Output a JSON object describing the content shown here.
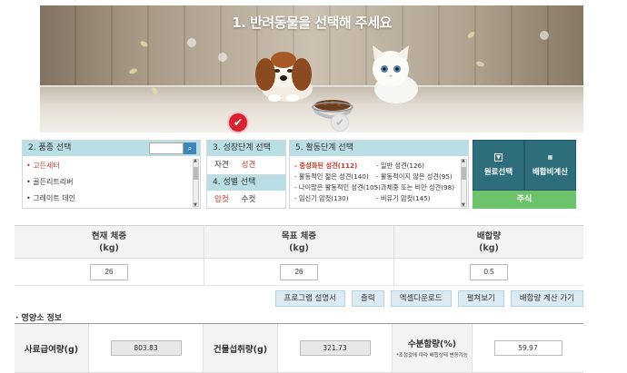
{
  "banner": {
    "title": "1. 반려동물을 선택해 주세요",
    "selected_animal": "dog"
  },
  "breed": {
    "header": "2. 품종 선택",
    "search": {
      "value": ""
    },
    "items": [
      "고든세터",
      "골든리트리버",
      "그레이트 데인"
    ],
    "selected_index": 0
  },
  "stage": {
    "header": "3. 성장단계 선택",
    "options": [
      "자견",
      "성견"
    ],
    "selected_index": 1
  },
  "gender": {
    "header": "4. 성별 선택",
    "options": [
      "암컷",
      "수컷"
    ],
    "selected_index": 0
  },
  "activity": {
    "header": "5. 활동단계 선택",
    "rows": [
      [
        "- 중성화된 성견(112)",
        "- 일반 성견(126)"
      ],
      [
        "- 활동적인 젊은 성견(140)",
        "- 활동적이지 않은 성견(95)"
      ],
      [
        "- 나이많은 활동적인 성견(105)",
        "- 과체중 또는 비만 성견(98)"
      ],
      [
        "- 임신기 암컷(130)",
        "- 비유기 암컷(145)"
      ]
    ],
    "selected": "- 중성화된 성견(112)"
  },
  "buttons": {
    "raw": "원료선택",
    "mix": "배합비계산",
    "main": "주식"
  },
  "weights": {
    "headers": [
      {
        "line1": "현재 체중",
        "line2": "(kg)"
      },
      {
        "line1": "목표 체중",
        "line2": "(kg)"
      },
      {
        "line1": "배합량",
        "line2": "(kg)"
      }
    ],
    "values": [
      "26",
      "26",
      "0.5"
    ]
  },
  "actions": [
    "프로그램 설명서",
    "출력",
    "엑셀다운로드",
    "펼쳐보기",
    "배합량 계산 가기"
  ],
  "nutrition": {
    "section_title": "· 영양소 정보",
    "feed_label": "사료급여량(g)",
    "feed_value": "803.83",
    "dry_label": "건물섭취량(g)",
    "dry_value": "321.73",
    "moisture_label": "수분함량(%)",
    "moisture_note": "*조정값에 따라 배합상태 변동가능",
    "moisture_value": "59.97"
  },
  "colors": {
    "panel_header": "#b9dee4",
    "dark_button": "#2e6e7c",
    "green_button": "#6cc36b",
    "selected_text": "#c0392b",
    "check_red": "#d7222f"
  }
}
